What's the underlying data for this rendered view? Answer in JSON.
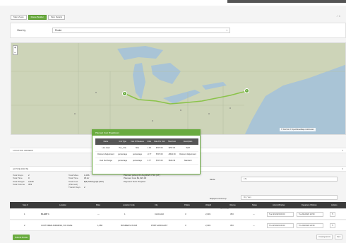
{
  "tabs": [
    "Map Views",
    "Route Builder",
    "Stop Details"
  ],
  "active_tab": 1,
  "corner_controls": "↗ ✕",
  "view": {
    "label": "View by",
    "value": "Route"
  },
  "map": {
    "zoom_in": "+",
    "zoom_out": "−",
    "markers": [
      "1",
      "2"
    ],
    "attribution": "© TomTom © OpenStreetMap contributors",
    "route_color": "#8bc34a",
    "water_color": "#a9c4d6",
    "land_color": "#c9d1b4"
  },
  "sections": {
    "location_header": "LOCATION ORDERS",
    "active_header": "ACTIVE ROUTE"
  },
  "popup": {
    "title": "Planned Cost Breakdown",
    "headers": [
      "Name",
      "Unit Type",
      "Cost Of Measure",
      "Units",
      "Rate Per Unit",
      "Total Cost",
      "Description"
    ],
    "rows": [
      [
        "Line Haul",
        "Per_mile",
        "Mile",
        "1.00",
        "$707.00",
        "$707.00",
        "Tariff"
      ],
      [
        "Discount Adjustment",
        "percentage",
        "percentage",
        "-0.77",
        "$707.00",
        "-$544.39",
        "Discount Adjustment"
      ],
      [
        "Fuel Surcharge",
        "percentage",
        "percentage",
        "0.77",
        "$707.00",
        "$544.39",
        "Standard"
      ]
    ]
  },
  "stats": [
    [
      "Total Stops",
      "2"
    ],
    [
      "Total Time",
      "0"
    ],
    [
      "Total Weight",
      "2,049"
    ],
    [
      "Total Volume",
      "353"
    ]
  ],
  "stats_mid": [
    [
      "Total Miles",
      "1,086"
    ],
    [
      "Total Time",
      "18 Hr"
    ],
    [
      "Total Cost (Planned)",
      "$(5) Mileage(8) (WK)"
    ],
    [
      "Transit Days",
      "2"
    ]
  ],
  "right_form": {
    "planned_pickup": "Planned pickup",
    "planned_pickup_val": "01 Aug/2023 7:00 (CT)",
    "planned_cost": "Planned Cost",
    "planned_cost_val": "$1,923.00",
    "payment_term": "Payment Term",
    "payment_term_val": "Prepaid",
    "mode_label": "Mode",
    "mode_value": "LTL",
    "equipment_label": "Equipment Group",
    "equipment_value": "Dry Van",
    "multimode_label": "Multimodal"
  },
  "table": {
    "headers": [
      "Stop #",
      "Location",
      "Miles",
      "Location Code",
      "City",
      "Pallets",
      "Weight",
      "Volume",
      "Notes",
      "Arrival Window",
      "Departure Window",
      "Actions"
    ],
    "rows": [
      [
        "1",
        "PLANT 1",
        "—",
        "1",
        "CHICAGO",
        "3",
        "2,049",
        "353",
        "—",
        "Tue 8/1/2023 00:00",
        "Tue 8/1/2023 23:59",
        "✎"
      ],
      [
        "2",
        "CUSTOMER ADDRESS, INC FAKE",
        "1,086",
        "BUSINESS IN 025",
        "PORTLAND EAST",
        "3",
        "2,049",
        "353",
        "—",
        "Thu 8/3/2023 00:00",
        "Thu 8/3/2023 23:59",
        "✎"
      ]
    ]
  },
  "buttons": {
    "submit": "Submit Route",
    "prev": "Unassigned Ac",
    "next": "Next"
  }
}
